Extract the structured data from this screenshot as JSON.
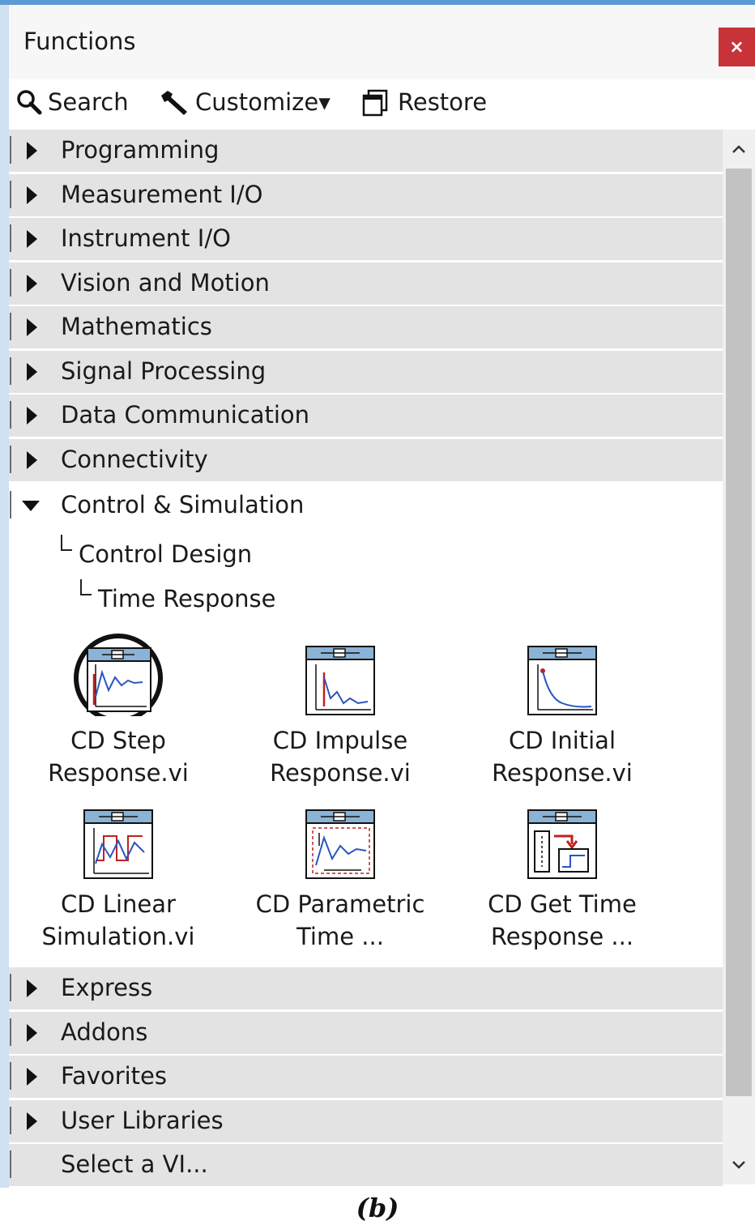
{
  "window": {
    "title": "Functions",
    "close_label": "×"
  },
  "toolbar": {
    "search": "Search",
    "customize": "Customize▾",
    "restore": "Restore"
  },
  "tree": {
    "categories_top": [
      "Programming",
      "Measurement I/O",
      "Instrument I/O",
      "Vision and Motion",
      "Mathematics",
      "Signal Processing",
      "Data Communication",
      "Connectivity"
    ],
    "expanded": {
      "label": "Control & Simulation",
      "path": [
        "Control Design",
        "Time Response"
      ]
    },
    "vis": [
      {
        "line1": "CD Step",
        "line2": "Response.vi",
        "icon": "step-response-icon",
        "highlighted": true
      },
      {
        "line1": "CD Impulse",
        "line2": "Response.vi",
        "icon": "impulse-response-icon"
      },
      {
        "line1": "CD Initial",
        "line2": "Response.vi",
        "icon": "initial-response-icon"
      },
      {
        "line1": "CD Linear",
        "line2": "Simulation.vi",
        "icon": "linear-simulation-icon"
      },
      {
        "line1": "CD Parametric",
        "line2": "Time ...",
        "icon": "parametric-time-icon"
      },
      {
        "line1": "CD Get Time",
        "line2": "Response ...",
        "icon": "get-time-response-icon"
      }
    ],
    "categories_bottom": [
      "Express",
      "Addons",
      "Favorites",
      "User Libraries"
    ],
    "select_vi": "Select a VI..."
  },
  "caption": "(b)",
  "colors": {
    "row_bg": "#e3e3e3",
    "close_btn": "#c8333a",
    "frame_accent": "#5b9bd5"
  }
}
